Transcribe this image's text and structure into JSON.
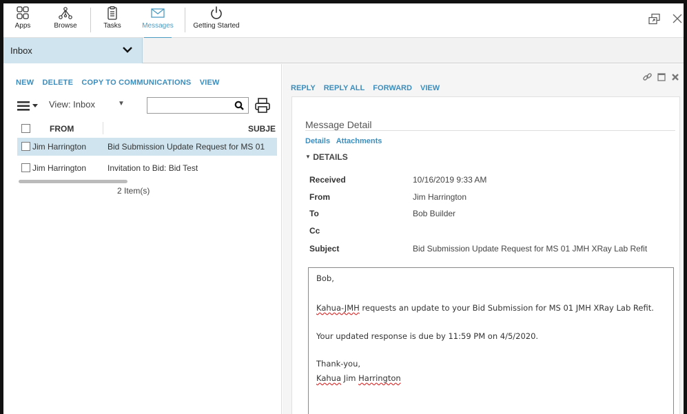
{
  "topbar": {
    "apps": [
      {
        "label": "Apps",
        "icon": "apps-grid-icon"
      },
      {
        "label": "Browse",
        "icon": "browse-network-icon"
      },
      {
        "label": "Tasks",
        "icon": "tasks-clipboard-icon"
      },
      {
        "label": "Messages",
        "icon": "envelope-icon",
        "active": true
      },
      {
        "label": "Getting Started",
        "icon": "power-icon"
      }
    ],
    "accent": "#4a9bc2"
  },
  "inbox_selector": {
    "value": "Inbox"
  },
  "list": {
    "actions": [
      "NEW",
      "DELETE",
      "COPY TO COMMUNICATIONS",
      "VIEW"
    ],
    "view_label": "View:  Inbox",
    "search_placeholder": "",
    "columns": {
      "from": "FROM",
      "subject": "SUBJE"
    },
    "rows": [
      {
        "from": "Jim Harrington",
        "subject": "Bid Submission Update Request for MS 01",
        "selected": true
      },
      {
        "from": "Jim Harrington",
        "subject": "Invitation to Bid: Bid Test",
        "selected": false
      }
    ],
    "count": "2 Item(s)"
  },
  "detail": {
    "actions": [
      "REPLY",
      "REPLY ALL",
      "FORWARD",
      "VIEW"
    ],
    "title": "Message Detail",
    "tabs": [
      "Details",
      "Attachments"
    ],
    "section": "DETAILS",
    "fields": {
      "received_label": "Received",
      "received": "10/16/2019 9:33 AM",
      "from_label": "From",
      "from": "Jim Harrington",
      "to_label": "To",
      "to": "Bob Builder",
      "cc_label": "Cc",
      "cc": "",
      "subject_label": "Subject",
      "subject": "Bid Submission Update Request for MS 01 JMH XRay Lab Refit"
    },
    "body": {
      "greeting": "Bob,",
      "line1_company": "Kahua-JMH",
      "line1_rest": " requests an update to your Bid Submission for MS 01 JMH XRay Lab Refit.",
      "line2": "Your updated response is due by 11:59 PM on 4/5/2020.",
      "closing": "Thank-you,",
      "sig_company": "Kahua",
      "sig_first": " Jim ",
      "sig_last": "Harrington"
    }
  },
  "colors": {
    "link": "#3c8dbc",
    "selected_row": "#cfe4ee"
  }
}
